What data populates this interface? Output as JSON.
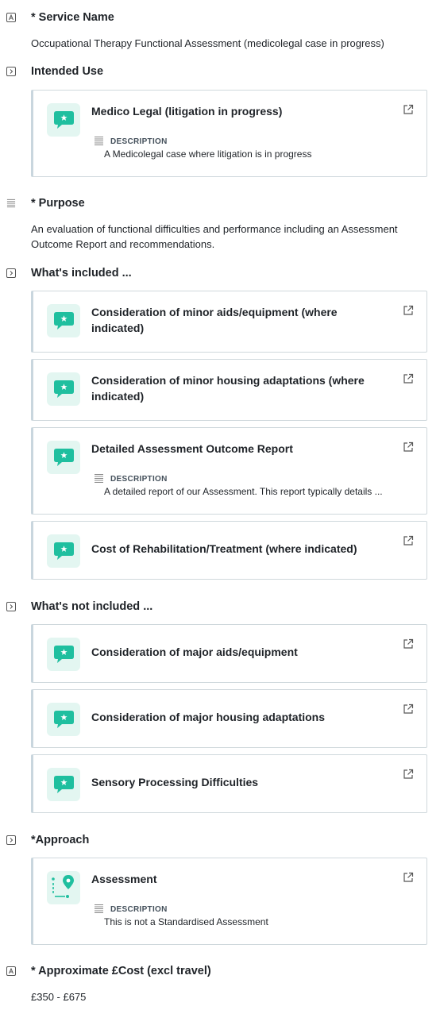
{
  "service_name": {
    "label": "* Service Name",
    "value": "Occupational Therapy Functional Assessment (medicolegal case in progress)"
  },
  "intended_use": {
    "label": "Intended Use",
    "card": {
      "title": "Medico Legal (litigation in progress)",
      "description_label": "DESCRIPTION",
      "description": "A Medicolegal case where litigation is in progress",
      "icon": "chat-star-icon"
    }
  },
  "purpose": {
    "label": "* Purpose",
    "value": "An evaluation of functional difficulties and performance including an Assessment Outcome Report and recommendations."
  },
  "whats_included": {
    "label": "What's included ...",
    "cards": [
      {
        "title": "Consideration of minor aids/equipment (where indicated)"
      },
      {
        "title": "Consideration of minor housing adaptations (where indicated)"
      },
      {
        "title": "Detailed Assessment Outcome Report",
        "description_label": "DESCRIPTION",
        "description": "A detailed report of our Assessment. This report typically details ..."
      },
      {
        "title": "Cost of Rehabilitation/Treatment (where indicated)"
      }
    ]
  },
  "whats_not_included": {
    "label": "What's not included ...",
    "cards": [
      {
        "title": "Consideration of major aids/equipment"
      },
      {
        "title": "Consideration of major housing adaptations"
      },
      {
        "title": "Sensory Processing Difficulties"
      }
    ]
  },
  "approach": {
    "label": "*Approach",
    "card": {
      "title": "Assessment",
      "description_label": "DESCRIPTION",
      "description": "This is not a Standardised Assessment",
      "icon": "route-pin-icon"
    }
  },
  "cost": {
    "label": "* Approximate £Cost (excl travel)",
    "value": "£350 - £675"
  },
  "colors": {
    "accent": "#1fbf9f",
    "accent_bg": "#e3f6f1",
    "card_border": "#cfd8dc"
  }
}
